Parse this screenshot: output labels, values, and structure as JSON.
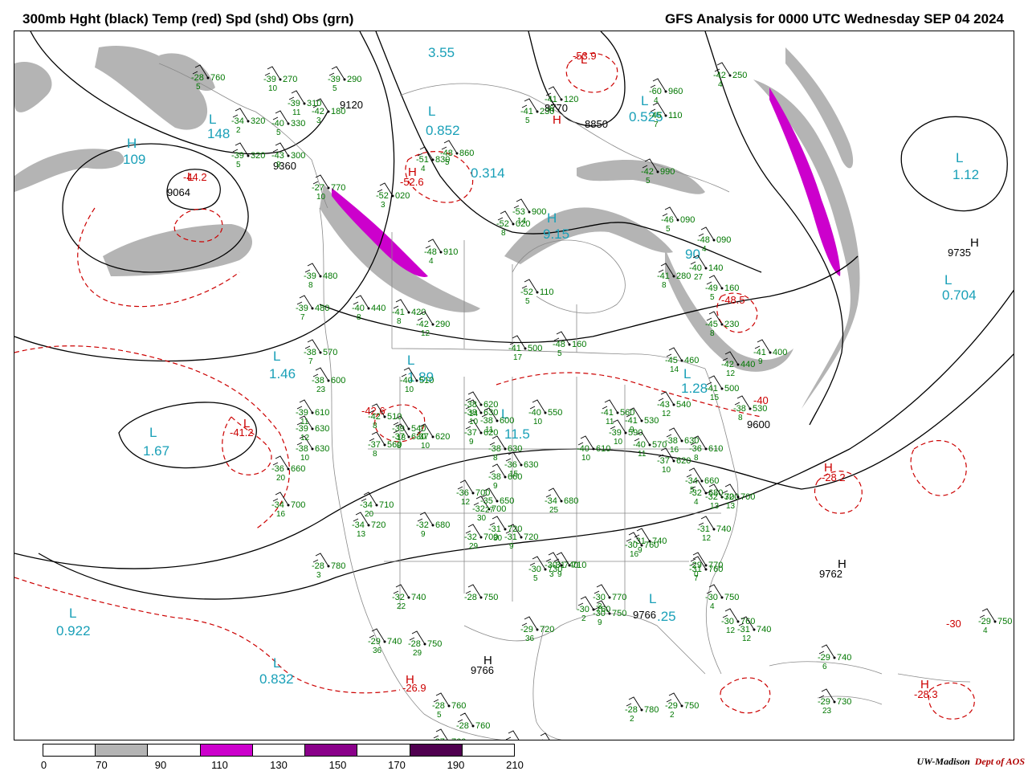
{
  "header": {
    "left_title": "300mb Hght (black) Temp (red) Spd (shd) Obs (grn)",
    "right_title": "GFS Analysis for 0000 UTC Wednesday  SEP 04 2024"
  },
  "colors": {
    "height_contour": "#000000",
    "temperature_contour": "#cc0000",
    "speed_70_90": "#b4b4b4",
    "speed_110_130": "#cc00cc",
    "speed_150_170": "#8a008a",
    "speed_190_210": "#500050",
    "observations": "#007700",
    "pressure_centers": "#1aa0b8",
    "borders": "#8a8a8a"
  },
  "legend": {
    "ticks": [
      "0",
      "70",
      "90",
      "110",
      "130",
      "150",
      "170",
      "190",
      "210"
    ],
    "fills": [
      "#ffffff",
      "#b4b4b4",
      "#ffffff",
      "#cc00cc",
      "#ffffff",
      "#8a008a",
      "#ffffff",
      "#500050",
      "#ffffff"
    ]
  },
  "height_labels": [
    {
      "t": "9120"
    },
    {
      "t": "8850"
    },
    {
      "t": "8770"
    },
    {
      "t": "9360"
    },
    {
      "t": "9064"
    },
    {
      "t": "9735"
    },
    {
      "t": "9600"
    },
    {
      "t": "9762"
    },
    {
      "t": "9766"
    },
    {
      "t": "9766"
    }
  ],
  "temp_labels": [
    {
      "t": "-53.9"
    },
    {
      "t": "-52.6"
    },
    {
      "t": "-44.2"
    },
    {
      "t": "-41.2"
    },
    {
      "t": "-42.6"
    },
    {
      "t": "-48.5"
    },
    {
      "t": "-40"
    },
    {
      "t": "-28.2"
    },
    {
      "t": "-26.9"
    },
    {
      "t": "-28.3"
    },
    {
      "t": "-30"
    }
  ],
  "centers": [
    {
      "t": "L"
    },
    {
      "t": "1.12"
    },
    {
      "t": "L"
    },
    {
      "t": "0.525"
    },
    {
      "t": "L"
    },
    {
      "t": "0.852"
    },
    {
      "t": "0.314"
    },
    {
      "t": "3.55"
    },
    {
      "t": "H"
    },
    {
      "t": "109"
    },
    {
      "t": "L"
    },
    {
      "t": "148"
    },
    {
      "t": "L"
    },
    {
      "t": "1.46"
    },
    {
      "t": "L"
    },
    {
      "t": "1.67"
    },
    {
      "t": "L"
    },
    {
      "t": "0.922"
    },
    {
      "t": "L"
    },
    {
      "t": "0.832"
    },
    {
      "t": "H"
    },
    {
      "t": "9.15"
    },
    {
      "t": "L"
    },
    {
      "t": "0.704"
    },
    {
      "t": "L"
    },
    {
      "t": "1.28"
    },
    {
      "t": "L"
    },
    {
      "t": "11.5"
    },
    {
      "t": "L"
    },
    {
      "t": "1.89"
    },
    {
      "t": "L"
    },
    {
      "t": ".25"
    },
    {
      "t": "90"
    }
  ],
  "center_markers": [
    {
      "t": "H"
    },
    {
      "t": "H"
    },
    {
      "t": "H"
    },
    {
      "t": "H"
    },
    {
      "t": "H"
    },
    {
      "t": "H"
    },
    {
      "t": "H"
    },
    {
      "t": "L"
    },
    {
      "t": "L"
    },
    {
      "t": "L"
    },
    {
      "t": "H"
    }
  ],
  "observations": [
    {
      "temp": "-42",
      "hgt": "250",
      "dew": "4"
    },
    {
      "temp": "-60",
      "hgt": "960",
      "dew": "4"
    },
    {
      "temp": "-45",
      "hgt": "110",
      "dew": "7"
    },
    {
      "temp": "-42",
      "hgt": "990",
      "dew": "5"
    },
    {
      "temp": "-46",
      "hgt": "090",
      "dew": "5"
    },
    {
      "temp": "-48",
      "hgt": "090",
      "dew": "4"
    },
    {
      "temp": "-41",
      "hgt": "280",
      "dew": "8"
    },
    {
      "temp": "-49",
      "hgt": "160",
      "dew": "5"
    },
    {
      "temp": "-40",
      "hgt": "140",
      "dew": "27"
    },
    {
      "temp": "-45",
      "hgt": "230",
      "dew": "8"
    },
    {
      "temp": "-41",
      "hgt": "400",
      "dew": "9"
    },
    {
      "temp": "-45",
      "hgt": "460",
      "dew": "14"
    },
    {
      "temp": "-42",
      "hgt": "440",
      "dew": "12"
    },
    {
      "temp": "-41",
      "hgt": "500",
      "dew": "15"
    },
    {
      "temp": "-38",
      "hgt": "530",
      "dew": "8"
    },
    {
      "temp": "-43",
      "hgt": "540",
      "dew": "12"
    },
    {
      "temp": "-41",
      "hgt": "530",
      "dew": "9"
    },
    {
      "temp": "-39",
      "hgt": "590",
      "dew": "10"
    },
    {
      "temp": "-41",
      "hgt": "560",
      "dew": "11"
    },
    {
      "temp": "-40",
      "hgt": "570",
      "dew": "11"
    },
    {
      "temp": "-36",
      "hgt": "610",
      "dew": "8"
    },
    {
      "temp": "-40",
      "hgt": "610",
      "dew": "10"
    },
    {
      "temp": "-37",
      "hgt": "620",
      "dew": "10"
    },
    {
      "temp": "-38",
      "hgt": "630",
      "dew": "16"
    },
    {
      "temp": "-34",
      "hgt": "660",
      "dew": "5"
    },
    {
      "temp": "-32",
      "hgt": "680",
      "dew": "4"
    },
    {
      "temp": "-32",
      "hgt": "700",
      "dew": "13"
    },
    {
      "temp": "-32",
      "hgt": "700",
      "dew": "13"
    },
    {
      "temp": "-31",
      "hgt": "740",
      "dew": "12"
    },
    {
      "temp": "-31",
      "hgt": "740",
      "dew": "9"
    },
    {
      "temp": "-31",
      "hgt": "760",
      "dew": "7"
    },
    {
      "temp": "-30",
      "hgt": "760",
      "dew": "16"
    },
    {
      "temp": "-29",
      "hgt": "770",
      "dew": "0"
    },
    {
      "temp": "-30",
      "hgt": "750",
      "dew": "4"
    },
    {
      "temp": "-30",
      "hgt": "760",
      "dew": "12"
    },
    {
      "temp": "-31",
      "hgt": "740",
      "dew": "12"
    },
    {
      "temp": "-29",
      "hgt": "750",
      "dew": "4"
    },
    {
      "temp": "-29",
      "hgt": "740",
      "dew": "6"
    },
    {
      "temp": "-29",
      "hgt": "730",
      "dew": "23"
    },
    {
      "temp": "-28",
      "hgt": "780",
      "dew": "2"
    },
    {
      "temp": "-29",
      "hgt": "750",
      "dew": "2"
    },
    {
      "temp": "-30",
      "hgt": "770",
      "dew": "3"
    },
    {
      "temp": "-30",
      "hgt": "750",
      "dew": "9"
    },
    {
      "temp": "-30",
      "hgt": "760",
      "dew": "2"
    },
    {
      "temp": "-31",
      "hgt": "720",
      "dew": "9"
    },
    {
      "temp": "-30",
      "hgt": "730",
      "dew": "5"
    },
    {
      "temp": "-30",
      "hgt": "740",
      "dew": "3"
    },
    {
      "temp": "-31",
      "hgt": "710",
      "dew": "9"
    },
    {
      "temp": "-32",
      "hgt": "700",
      "dew": "29"
    },
    {
      "temp": "-31",
      "hgt": "720",
      "dew": "30"
    },
    {
      "temp": "-32",
      "hgt": "680",
      "dew": "9"
    },
    {
      "temp": "-32",
      "hgt": "700",
      "dew": "30"
    },
    {
      "temp": "-35",
      "hgt": "650",
      "dew": "27"
    },
    {
      "temp": "-34",
      "hgt": "680",
      "dew": "25"
    },
    {
      "temp": "-38",
      "hgt": "660",
      "dew": "9"
    },
    {
      "temp": "-36",
      "hgt": "630",
      "dew": "15"
    },
    {
      "temp": "-38",
      "hgt": "630",
      "dew": "8"
    },
    {
      "temp": "-37",
      "hgt": "620",
      "dew": "9"
    },
    {
      "temp": "-38",
      "hgt": "630",
      "dew": "10"
    },
    {
      "temp": "-38",
      "hgt": "600",
      "dew": "11"
    },
    {
      "temp": "-38",
      "hgt": "620",
      "dew": "14"
    },
    {
      "temp": "-40",
      "hgt": "550",
      "dew": "10"
    },
    {
      "temp": "-39",
      "hgt": "540",
      "dew": "18"
    },
    {
      "temp": "-40",
      "hgt": "510",
      "dew": "10"
    },
    {
      "temp": "-42",
      "hgt": "510",
      "dew": "8"
    },
    {
      "temp": "-37",
      "hgt": "620",
      "dew": "10"
    },
    {
      "temp": "-37",
      "hgt": "630",
      "dew": "8"
    },
    {
      "temp": "-37",
      "hgt": "560",
      "dew": "8"
    },
    {
      "temp": "-36",
      "hgt": "700",
      "dew": "12"
    },
    {
      "temp": "-34",
      "hgt": "720",
      "dew": "13"
    },
    {
      "temp": "-34",
      "hgt": "710",
      "dew": "20"
    },
    {
      "temp": "-34",
      "hgt": "700",
      "dew": "16"
    },
    {
      "temp": "-36",
      "hgt": "660",
      "dew": "20"
    },
    {
      "temp": "-38",
      "hgt": "630",
      "dew": "10"
    },
    {
      "temp": "-39",
      "hgt": "630",
      "dew": "12"
    },
    {
      "temp": "-39",
      "hgt": "610",
      "dew": "11"
    },
    {
      "temp": "-38",
      "hgt": "600",
      "dew": "23"
    },
    {
      "temp": "-38",
      "hgt": "570",
      "dew": "7"
    },
    {
      "temp": "-39",
      "hgt": "480",
      "dew": "7"
    },
    {
      "temp": "-39",
      "hgt": "480",
      "dew": "8"
    },
    {
      "temp": "-40",
      "hgt": "440",
      "dew": "8"
    },
    {
      "temp": "-41",
      "hgt": "420",
      "dew": "8"
    },
    {
      "temp": "-42",
      "hgt": "290",
      "dew": "12"
    },
    {
      "temp": "-41",
      "hgt": "500",
      "dew": "17"
    },
    {
      "temp": "-52",
      "hgt": "110",
      "dew": "5"
    },
    {
      "temp": "-48",
      "hgt": "160",
      "dew": "5"
    },
    {
      "temp": "-48",
      "hgt": "910",
      "dew": "4"
    },
    {
      "temp": "-52",
      "hgt": "020",
      "dew": "8"
    },
    {
      "temp": "-53",
      "hgt": "900",
      "dew": "14"
    },
    {
      "temp": "-52",
      "hgt": "020",
      "dew": "3"
    },
    {
      "temp": "-51",
      "hgt": "830",
      "dew": "4"
    },
    {
      "temp": "-48",
      "hgt": "860",
      "dew": "5"
    },
    {
      "temp": "-41",
      "hgt": "230",
      "dew": "5"
    },
    {
      "temp": "-41",
      "hgt": "120",
      "dew": "6"
    },
    {
      "temp": "-42",
      "hgt": "180",
      "dew": "3"
    },
    {
      "temp": "-39",
      "hgt": "290",
      "dew": "5"
    },
    {
      "temp": "-39",
      "hgt": "270",
      "dew": "10"
    },
    {
      "temp": "-39",
      "hgt": "310",
      "dew": "11"
    },
    {
      "temp": "-40",
      "hgt": "330",
      "dew": "5"
    },
    {
      "temp": "-43",
      "hgt": "300",
      "dew": "9"
    },
    {
      "temp": "-39",
      "hgt": "320",
      "dew": "5"
    },
    {
      "temp": "-34",
      "hgt": "320",
      "dew": "2"
    },
    {
      "temp": "-28",
      "hgt": "760",
      "dew": "5"
    },
    {
      "temp": "-27",
      "hgt": "770",
      "dew": "10"
    },
    {
      "temp": "-28",
      "hgt": "760",
      "dew": "5"
    },
    {
      "temp": "-28",
      "hgt": "760",
      "dew": ""
    },
    {
      "temp": "-27",
      "hgt": "760",
      "dew": ""
    },
    {
      "temp": "-28",
      "hgt": "760",
      "dew": ""
    },
    {
      "temp": "-28",
      "hgt": "750",
      "dew": "37"
    },
    {
      "temp": "-29",
      "hgt": "770",
      "dew": "35"
    },
    {
      "temp": "-28",
      "hgt": "750",
      "dew": "29"
    },
    {
      "temp": "-29",
      "hgt": "740",
      "dew": "36"
    },
    {
      "temp": "-29",
      "hgt": "720",
      "dew": "36"
    },
    {
      "temp": "-32",
      "hgt": "740",
      "dew": "22"
    },
    {
      "temp": "-28",
      "hgt": "750",
      "dew": ""
    },
    {
      "temp": "-28",
      "hgt": "780",
      "dew": "3"
    }
  ]
}
